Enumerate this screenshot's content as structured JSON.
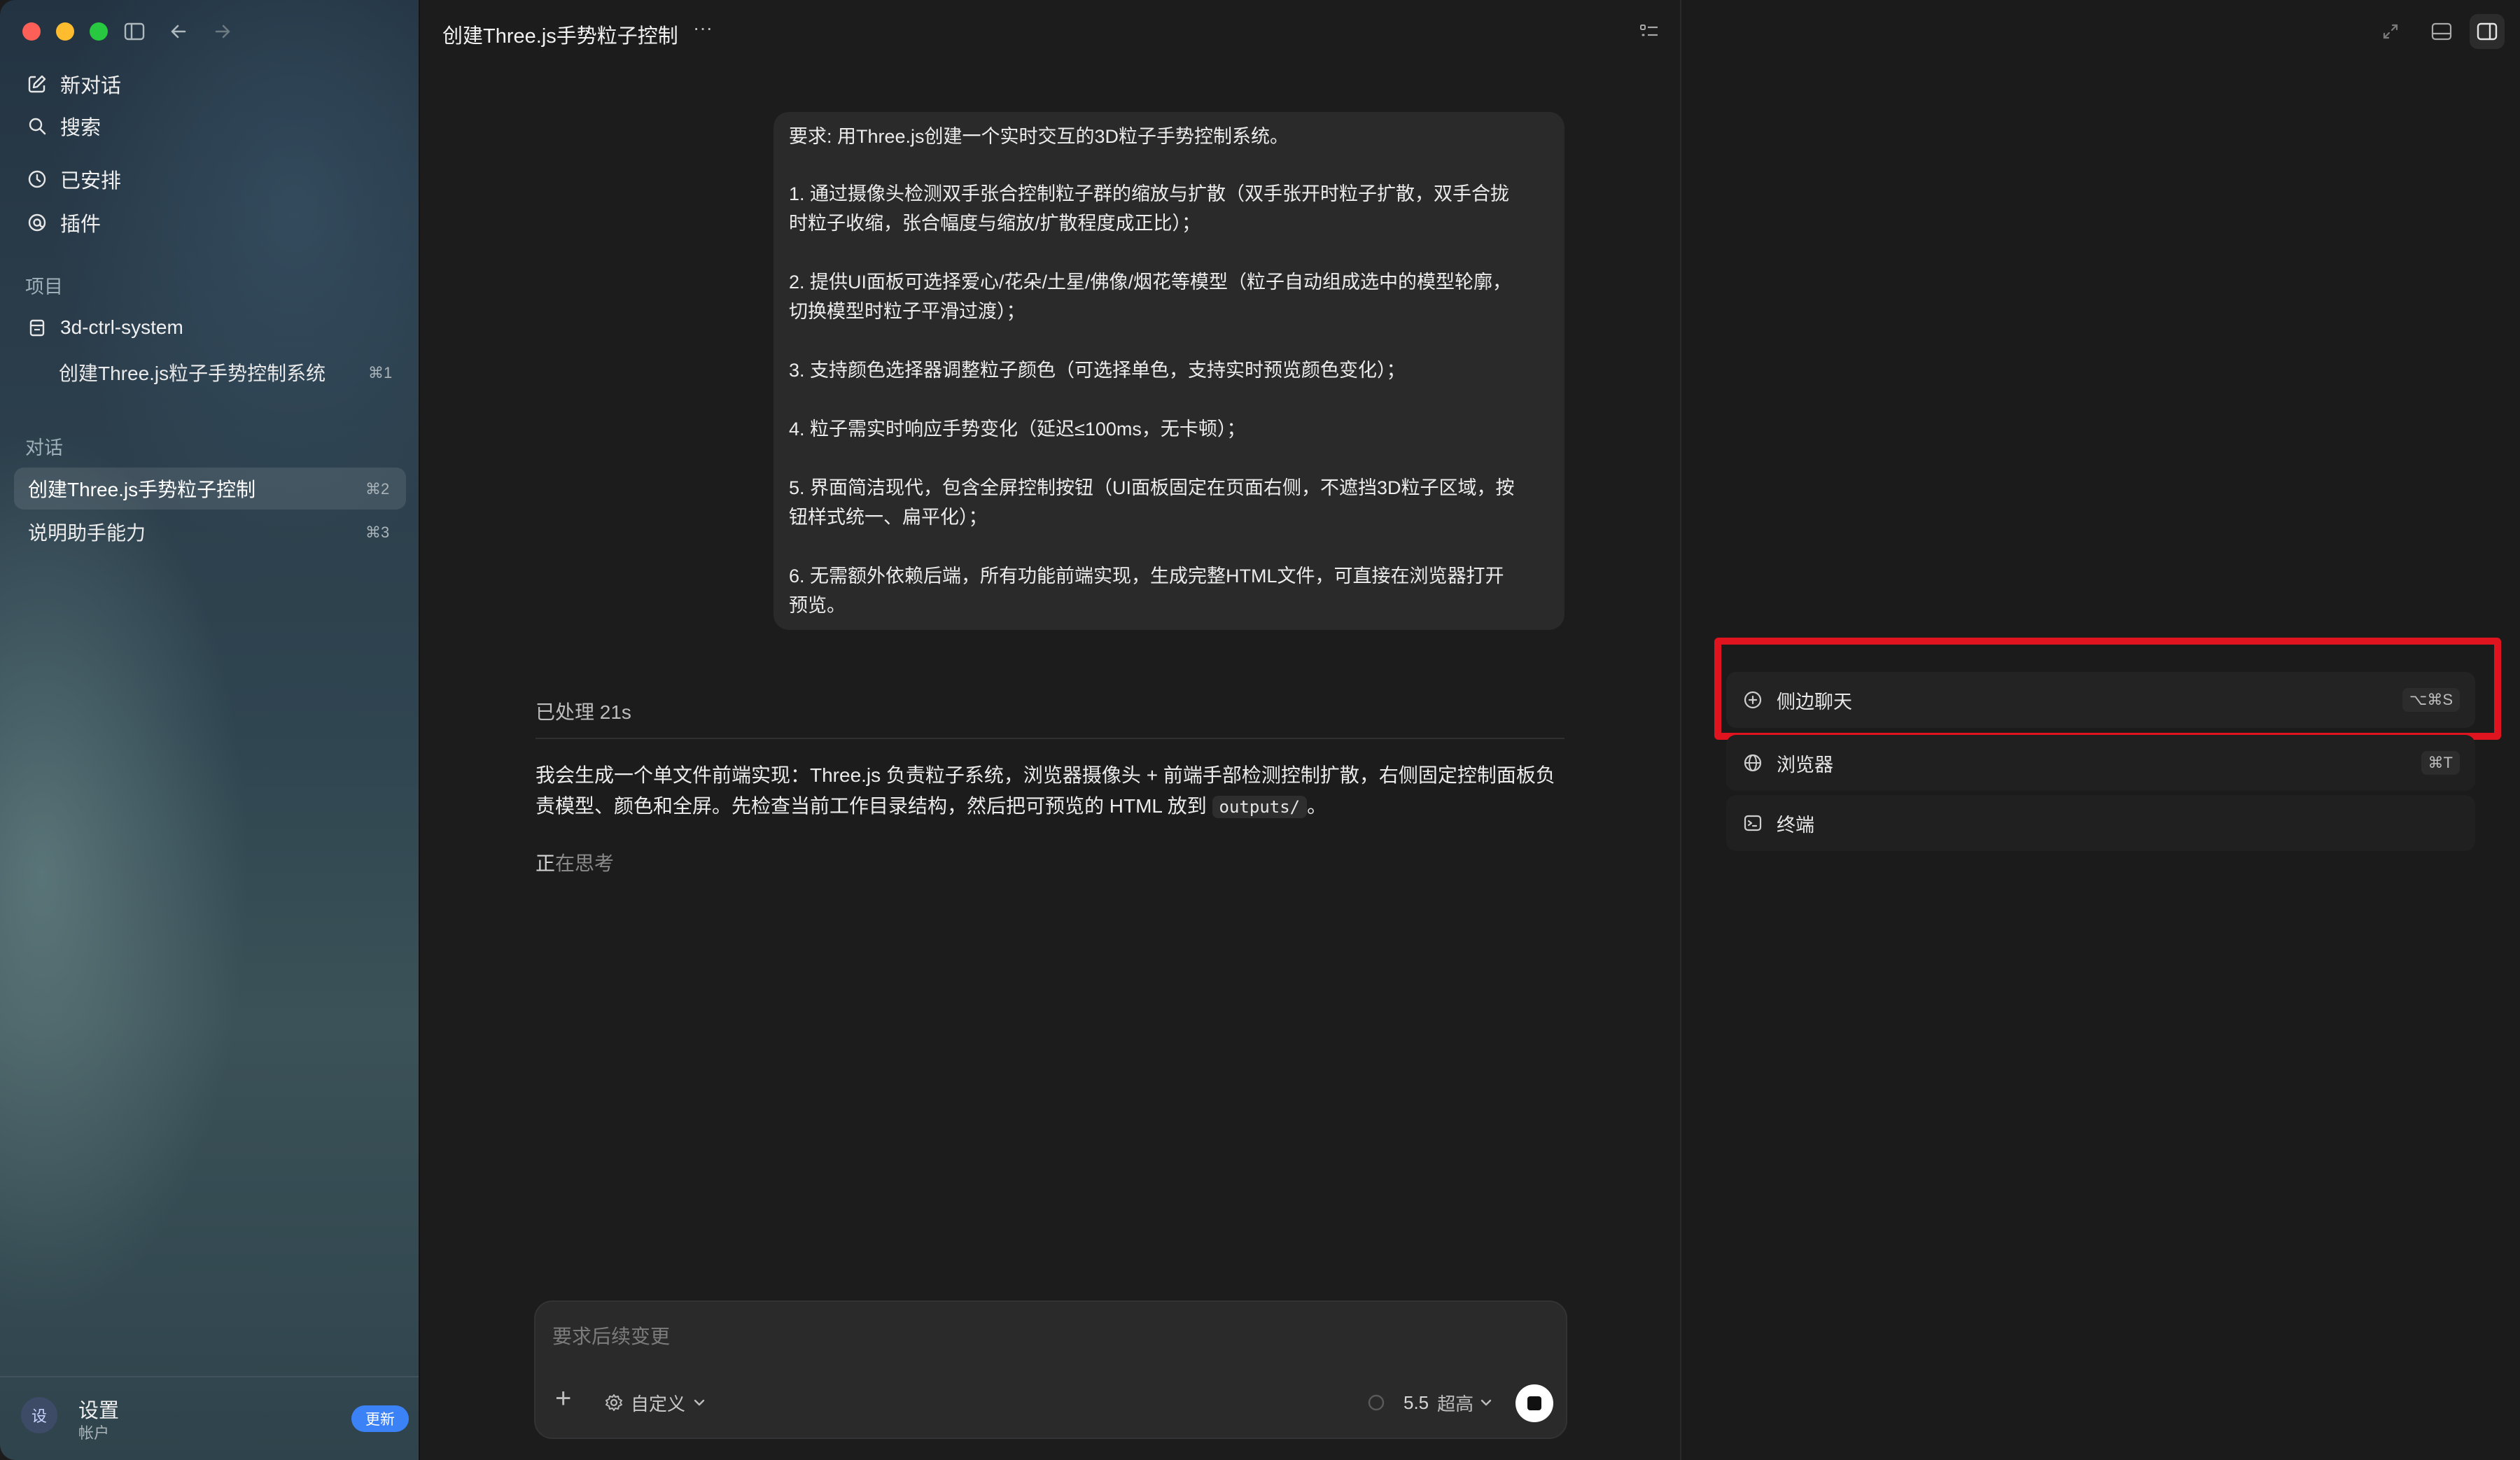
{
  "window": {
    "title": "创建Three.js手势粒子控制",
    "more_label": "···"
  },
  "sidebar": {
    "top_items": [
      {
        "label": "新对话",
        "icon": "compose-icon"
      },
      {
        "label": "搜索",
        "icon": "search-icon"
      },
      {
        "label": "已安排",
        "icon": "clock-icon"
      },
      {
        "label": "插件",
        "icon": "plugin-icon"
      }
    ],
    "projects_heading": "项目",
    "project": {
      "name": "3d-ctrl-system",
      "icon": "folder-icon"
    },
    "project_thread": {
      "label": "创建Three.js粒子手势控制系统",
      "shortcut": "⌘1"
    },
    "conversations_heading": "对话",
    "conversations": [
      {
        "label": "创建Three.js手势粒子控制",
        "shortcut": "⌘2",
        "active": true
      },
      {
        "label": "说明助手能力",
        "shortcut": "⌘3",
        "active": false
      }
    ],
    "footer": {
      "avatar": "设",
      "name": "设置",
      "sub": "帐户",
      "update_badge": "更新"
    }
  },
  "user_message": {
    "lines": [
      "要求: 用Three.js创建一个实时交互的3D粒子手势控制系统。",
      "1. 通过摄像头检测双手张合控制粒子群的缩放与扩散（双手张开时粒子扩散，双手合拢",
      "时粒子收缩，张合幅度与缩放/扩散程度成正比）；",
      "2. 提供UI面板可选择爱心/花朵/土星/佛像/烟花等模型（粒子自动组成选中的模型轮廓，",
      "切换模型时粒子平滑过渡）；",
      "3. 支持颜色选择器调整粒子颜色（可选择单色，支持实时预览颜色变化）；",
      "4. 粒子需实时响应手势变化（延迟≤100ms，无卡顿）；",
      "5. 界面简洁现代，包含全屏控制按钮（UI面板固定在页面右侧，不遮挡3D粒子区域，按",
      "钮样式统一、扁平化）；",
      "6. 无需额外依赖后端，所有功能前端实现，生成完整HTML文件，可直接在浏览器打开",
      "预览。"
    ]
  },
  "assistant": {
    "processed_label": "已处理 21s",
    "line1": "我会生成一个单文件前端实现：Three.js 负责粒子系统，浏览器摄像头 + 前端手部检测控制扩散，右侧固定控制面板负",
    "line2_prefix": "责模型、颜色和全屏。先检查当前工作目录结构，然后把可预览的 HTML 放到",
    "line2_code": "outputs/",
    "line2_suffix": "。",
    "thinking_first": "正",
    "thinking_rest": "在思考"
  },
  "composer": {
    "placeholder": "要求后续变更",
    "add_label": "+",
    "mode_label": "自定义",
    "model_version": "5.5",
    "model_level": "超高"
  },
  "right_panel": {
    "items": [
      {
        "label": "侧边聊天",
        "shortcut": "⌥⌘S",
        "icon": "plus-circle-icon",
        "highlighted": true
      },
      {
        "label": "浏览器",
        "shortcut": "⌘T",
        "icon": "globe-icon",
        "highlighted": false
      },
      {
        "label": "终端",
        "shortcut": "",
        "icon": "terminal-icon",
        "highlighted": false
      }
    ],
    "highlight_color": "#e0141e"
  },
  "colors": {
    "accent_blue": "#3b82f6",
    "highlight_red": "#e0141e"
  }
}
